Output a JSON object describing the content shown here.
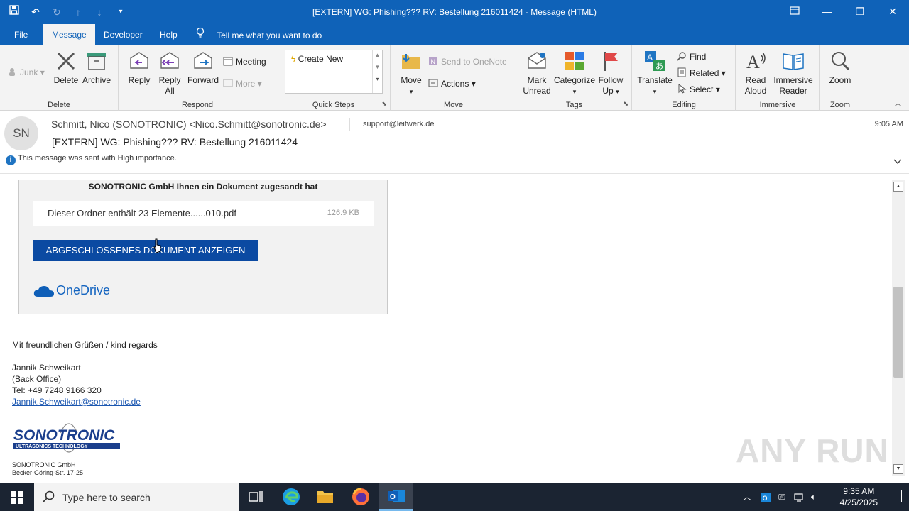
{
  "window": {
    "title": "[EXTERN] WG: Phishing???  RV: Bestellung 216011424  -  Message (HTML)"
  },
  "menu": {
    "tabs": [
      "File",
      "Message",
      "Developer",
      "Help"
    ],
    "active_tab": "Message",
    "tell_me": "Tell me what you want to do"
  },
  "ribbon": {
    "delete_group": {
      "label": "Delete",
      "junk": "Junk",
      "delete": "Delete",
      "archive": "Archive"
    },
    "respond_group": {
      "label": "Respond",
      "reply": "Reply",
      "reply_all_1": "Reply",
      "reply_all_2": "All",
      "forward": "Forward",
      "meeting": "Meeting",
      "more": "More"
    },
    "quick_steps_group": {
      "label": "Quick Steps",
      "create_new": "Create New"
    },
    "move_group": {
      "label": "Move",
      "move": "Move",
      "send_to_onenote": "Send to OneNote",
      "actions": "Actions"
    },
    "tags_group": {
      "label": "Tags",
      "mark_unread_1": "Mark",
      "mark_unread_2": "Unread",
      "categorize": "Categorize",
      "follow_up_1": "Follow",
      "follow_up_2": "Up"
    },
    "editing_group": {
      "label": "Editing",
      "translate": "Translate",
      "find": "Find",
      "related": "Related",
      "select": "Select"
    },
    "immersive_group": {
      "label": "Immersive",
      "read_aloud_1": "Read",
      "read_aloud_2": "Aloud",
      "immersive_reader_1": "Immersive",
      "immersive_reader_2": "Reader"
    },
    "zoom_group": {
      "label": "Zoom",
      "zoom": "Zoom"
    }
  },
  "message": {
    "avatar_initials": "SN",
    "from": "Schmitt, Nico (SONOTRONIC) <Nico.Schmitt@sonotronic.de>",
    "to": "support@leitwerk.de",
    "time": "9:05 AM",
    "subject": "[EXTERN] WG: Phishing???   RV: Bestellung 216011424",
    "importance_note": "This message was sent with High importance."
  },
  "body": {
    "card_title": "SONOTRONIC GmbH Ihnen ein Dokument zugesandt hat",
    "file_name": "Dieser Ordner enthält 23 Elemente......010.pdf",
    "file_size": "126.9 KB",
    "view_button": "ABGESCHLOSSENES DOKUMENT ANZEIGEN",
    "onedrive_label": "OneDrive",
    "greeting": "Mit freundlichen Grüßen / kind regards",
    "sig_name": "Jannik Schweikart",
    "sig_role": "(Back Office)",
    "sig_tel": "Tel: +49 7248 9166 320",
    "sig_email": "Jannik.Schweikart@sonotronic.de",
    "logo_text": "SONOTRONIC",
    "logo_sub": "ULTRASONICS TECHNOLOGY",
    "company_name": "SONOTRONIC GmbH",
    "company_street": "Becker-Göring-Str. 17-25"
  },
  "watermark": "ANY RUN",
  "taskbar": {
    "search_placeholder": "Type here to search",
    "time": "9:35 AM",
    "date": "4/25/2025"
  }
}
